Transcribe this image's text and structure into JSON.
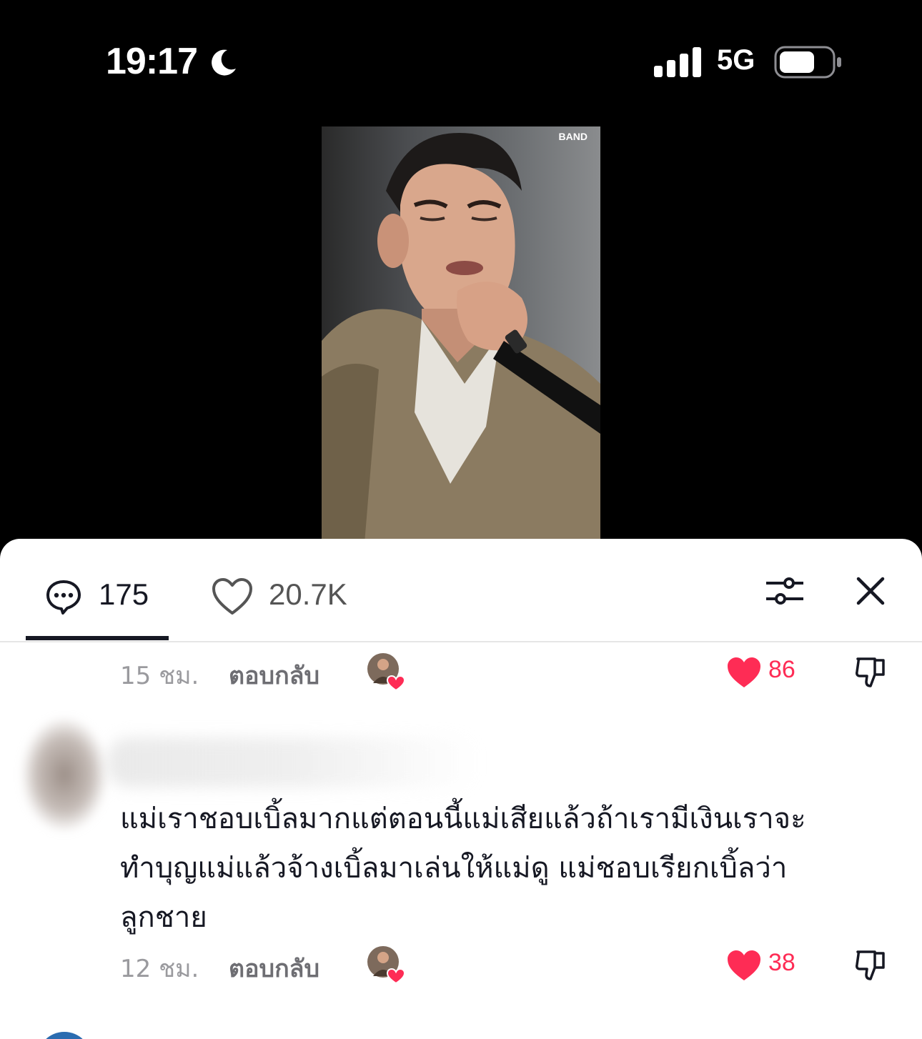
{
  "status_bar": {
    "time": "19:17",
    "network": "5G",
    "icons": [
      "moon-icon",
      "signal-icon",
      "battery-icon"
    ]
  },
  "video": {
    "watermark": "BAND"
  },
  "tabs": {
    "comments_count": "175",
    "likes_count": "20.7K",
    "icons": [
      "comment-icon",
      "heart-outline-icon",
      "filter-icon",
      "close-icon"
    ]
  },
  "comments": [
    {
      "time": "15 ชม.",
      "reply_label": "ตอบกลับ",
      "likes": "86"
    },
    {
      "text": "แม่เราชอบเบิ้ลมากแต่ตอนนี้แม่เสียแล้วถ้าเรามีเงินเราจะทำบุญแม่แล้วจ้างเบิ้ลมาเล่นให้แม่ดู แม่ชอบเรียกเบิ้ลว่าลูกชาย",
      "time": "12 ชม.",
      "reply_label": "ตอบกลับ",
      "likes": "38"
    }
  ],
  "colors": {
    "like_red": "#fe2c55",
    "text_dark": "#161823",
    "text_muted": "#9a9a9e"
  }
}
